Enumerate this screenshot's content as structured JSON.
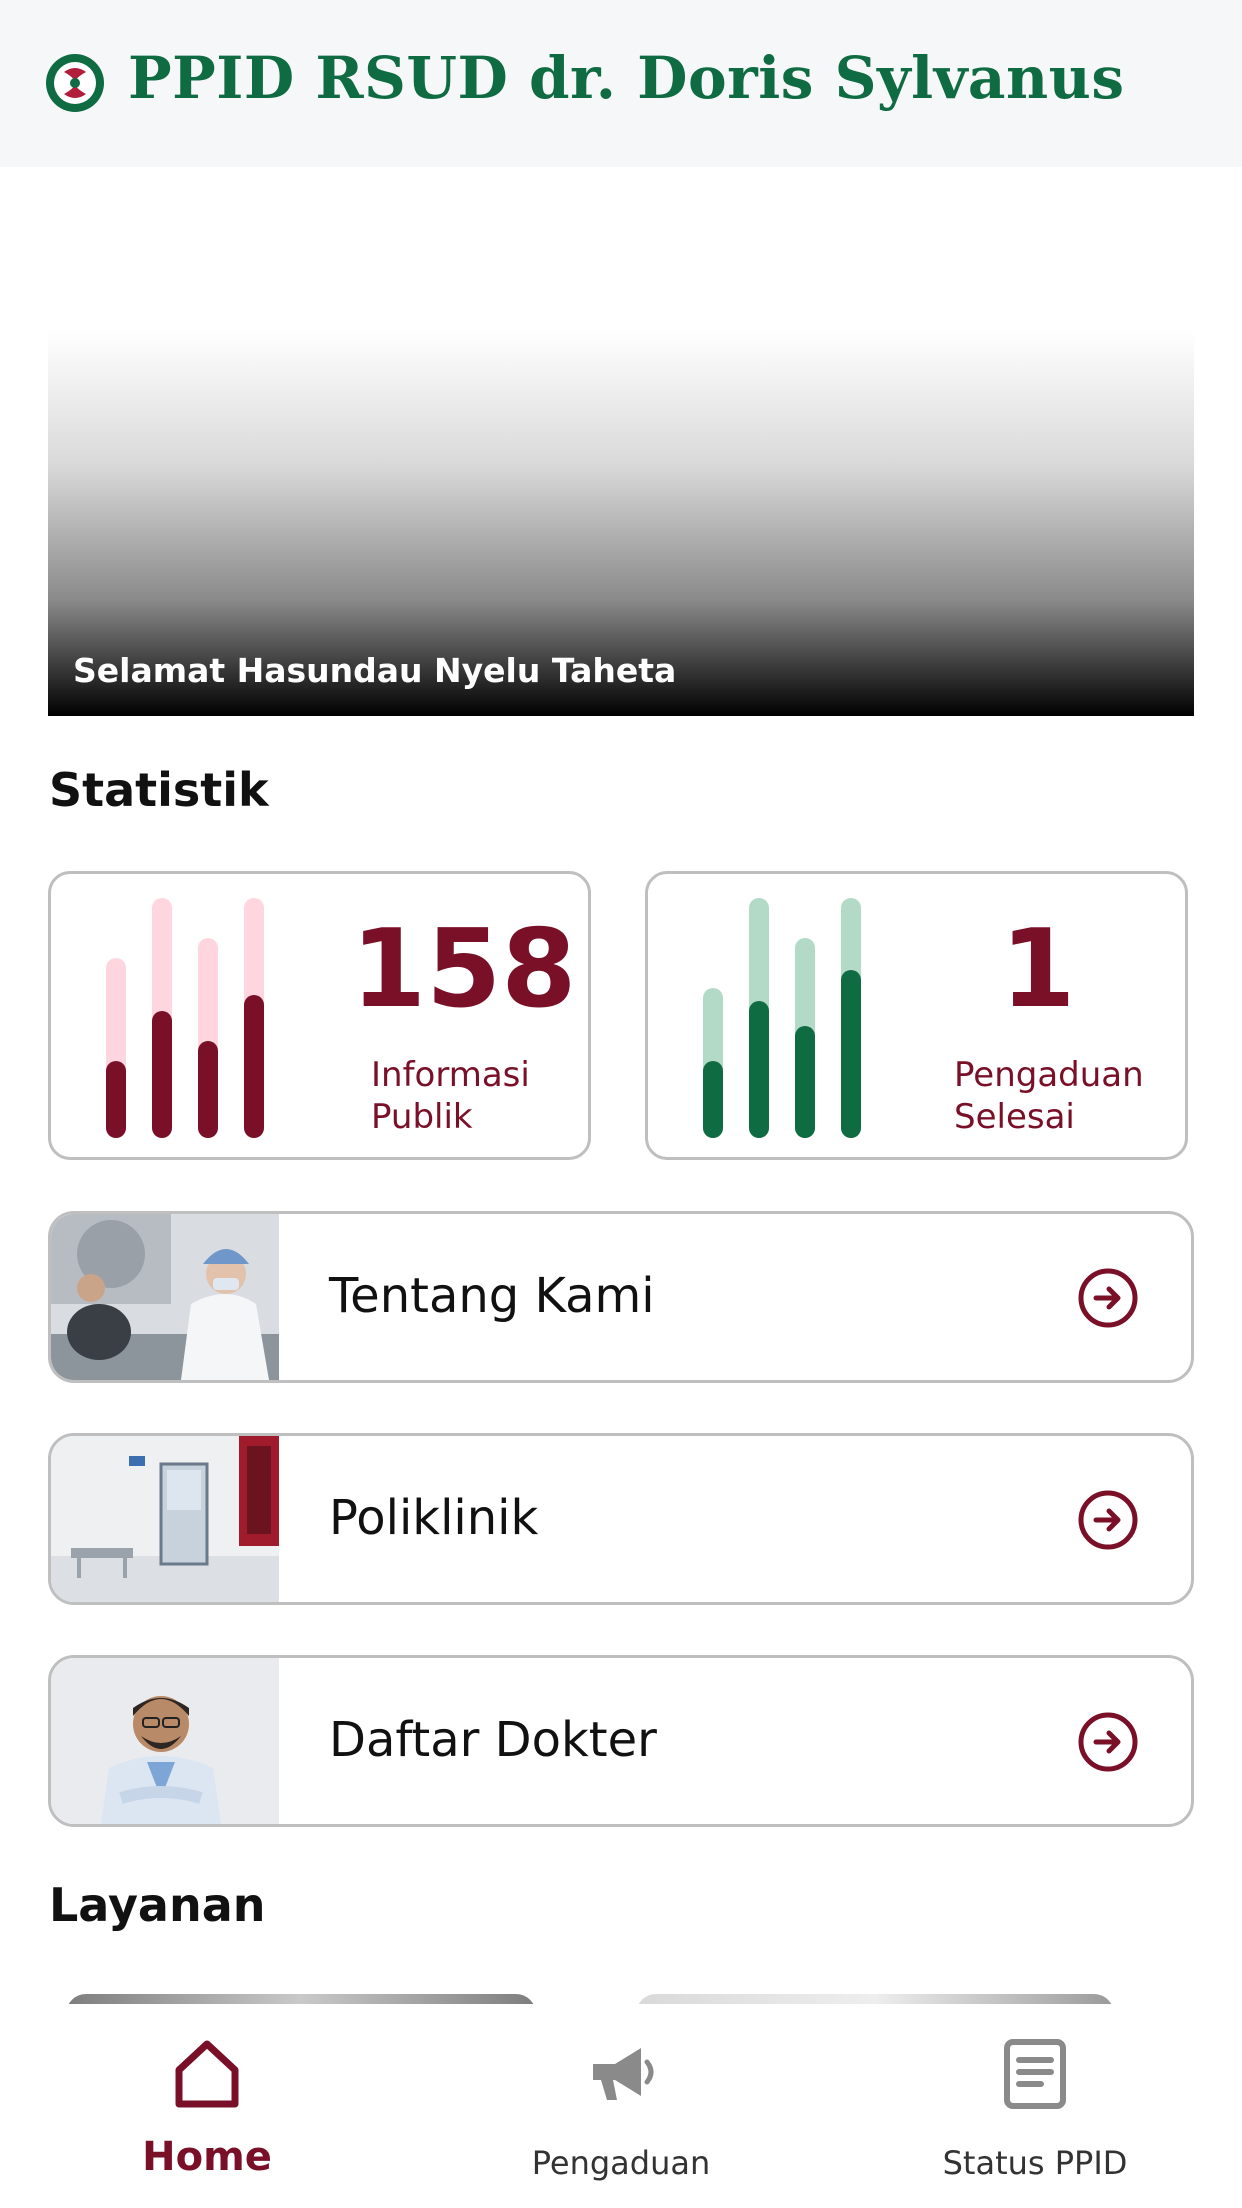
{
  "header": {
    "title": "PPID RSUD dr. Doris Sylvanus",
    "logo_icon": "hospital-logo-icon"
  },
  "hero": {
    "caption": "Selamat Hasundau Nyelu Taheta"
  },
  "statistik": {
    "title": "Statistik",
    "cards": [
      {
        "value": "158",
        "label_line1": "Informasi",
        "label_line2": "Publik",
        "value_color": "#7a1028",
        "bar_color": "#7a1028",
        "bar_bg": "#ffd6e0"
      },
      {
        "value": "1",
        "label_line1": "Pengaduan",
        "label_line2": "Selesai",
        "value_color": "#7a1028",
        "bar_color": "#0f6b42",
        "bar_bg": "#b2dac7"
      }
    ]
  },
  "menu": [
    {
      "label": "Tentang Kami",
      "thumb": "lab-staff-photo",
      "icon": "arrow-right-circle-icon"
    },
    {
      "label": "Poliklinik",
      "thumb": "clinic-room-photo",
      "icon": "arrow-right-circle-icon"
    },
    {
      "label": "Daftar Dokter",
      "thumb": "doctor-photo",
      "icon": "arrow-right-circle-icon"
    }
  ],
  "layanan": {
    "title": "Layanan"
  },
  "nav": {
    "items": [
      {
        "label": "Home",
        "icon": "home-icon",
        "active": true
      },
      {
        "label": "Pengaduan",
        "icon": "megaphone-icon",
        "active": false
      },
      {
        "label": "Status PPID",
        "icon": "document-icon",
        "active": false
      }
    ],
    "active_color": "#7a1028",
    "inactive_color": "#8a8a8a"
  }
}
